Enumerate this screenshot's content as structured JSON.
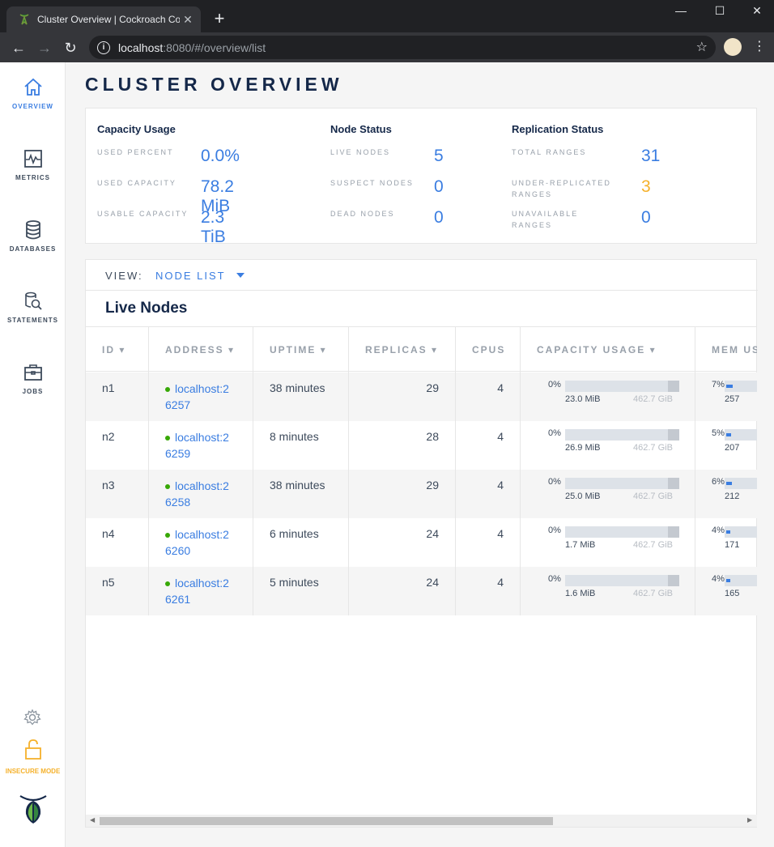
{
  "browser": {
    "tab_title": "Cluster Overview | Cockroach Console",
    "tab_close": "✕",
    "new_tab": "+",
    "minimize": "—",
    "maximize": "☐",
    "close": "✕",
    "url_host": "localhost",
    "url_rest": ":8080/#/overview/list",
    "back": "←",
    "forward": "→",
    "reload": "↻",
    "star": "☆",
    "menu": "⋮"
  },
  "sidebar": {
    "items": [
      {
        "label": "OVERVIEW",
        "icon": "home-icon",
        "active": true
      },
      {
        "label": "METRICS",
        "icon": "metrics-icon"
      },
      {
        "label": "DATABASES",
        "icon": "database-icon"
      },
      {
        "label": "STATEMENTS",
        "icon": "statements-icon"
      },
      {
        "label": "JOBS",
        "icon": "jobs-icon"
      }
    ],
    "insecure_label": "INSECURE MODE"
  },
  "page": {
    "title": "CLUSTER OVERVIEW"
  },
  "summary": {
    "capacity": {
      "title": "Capacity Usage",
      "used_percent_label": "USED PERCENT",
      "used_percent": "0.0%",
      "used_capacity_label": "USED CAPACITY",
      "used_capacity": "78.2 MiB",
      "usable_capacity_label": "USABLE CAPACITY",
      "usable_capacity": "2.3 TiB"
    },
    "node_status": {
      "title": "Node Status",
      "live_label": "LIVE NODES",
      "live": "5",
      "suspect_label": "SUSPECT NODES",
      "suspect": "0",
      "dead_label": "DEAD NODES",
      "dead": "0"
    },
    "replication": {
      "title": "Replication Status",
      "total_label": "TOTAL RANGES",
      "total": "31",
      "under_label": "UNDER-REPLICATED RANGES",
      "under": "3",
      "unavailable_label": "UNAVAILABLE RANGES",
      "unavailable": "0"
    },
    "colors": {
      "accent": "#3a7de1",
      "warning": "#f5b12b"
    }
  },
  "nodes": {
    "view_label": "VIEW:",
    "view_value": "NODE LIST",
    "section_title": "Live Nodes",
    "columns": {
      "id": "ID ▾",
      "address": "ADDRESS ▾",
      "uptime": "UPTIME ▾",
      "replicas": "REPLICAS ▾",
      "cpus": "CPUS",
      "capacity": "CAPACITY USAGE ▾",
      "mem": "MEM USAGE ▾"
    },
    "rows": [
      {
        "id": "n1",
        "addr1": "localhost:2",
        "addr2": "6257",
        "uptime": "38 minutes",
        "replicas": "29",
        "cpus": "4",
        "cap_pct": "0%",
        "cap_used": "23.0 MiB",
        "cap_total": "462.7 GiB",
        "mem_pct": "7%",
        "mem_used": "257",
        "mem_fraction": 0.07
      },
      {
        "id": "n2",
        "addr1": "localhost:2",
        "addr2": "6259",
        "uptime": "8 minutes",
        "replicas": "28",
        "cpus": "4",
        "cap_pct": "0%",
        "cap_used": "26.9 MiB",
        "cap_total": "462.7 GiB",
        "mem_pct": "5%",
        "mem_used": "207",
        "mem_fraction": 0.05
      },
      {
        "id": "n3",
        "addr1": "localhost:2",
        "addr2": "6258",
        "uptime": "38 minutes",
        "replicas": "29",
        "cpus": "4",
        "cap_pct": "0%",
        "cap_used": "25.0 MiB",
        "cap_total": "462.7 GiB",
        "mem_pct": "6%",
        "mem_used": "212",
        "mem_fraction": 0.06
      },
      {
        "id": "n4",
        "addr1": "localhost:2",
        "addr2": "6260",
        "uptime": "6 minutes",
        "replicas": "24",
        "cpus": "4",
        "cap_pct": "0%",
        "cap_used": "1.7 MiB",
        "cap_total": "462.7 GiB",
        "mem_pct": "4%",
        "mem_used": "171",
        "mem_fraction": 0.04
      },
      {
        "id": "n5",
        "addr1": "localhost:2",
        "addr2": "6261",
        "uptime": "5 minutes",
        "replicas": "24",
        "cpus": "4",
        "cap_pct": "0%",
        "cap_used": "1.6 MiB",
        "cap_total": "462.7 GiB",
        "mem_pct": "4%",
        "mem_used": "165",
        "mem_fraction": 0.04
      }
    ]
  }
}
